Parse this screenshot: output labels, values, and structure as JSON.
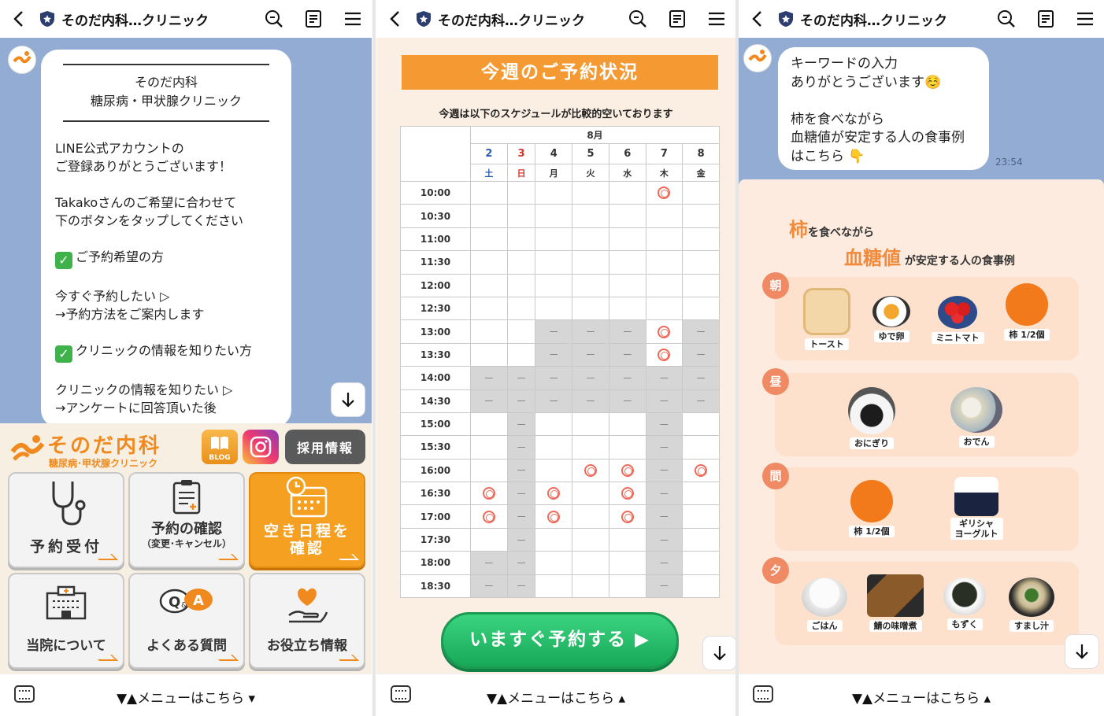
{
  "header": {
    "title": "そのだ内科…クリニック"
  },
  "footer": {
    "menu_label_1": "▼▲メニューはこちら ▾",
    "menu_label_2": "▼▲メニューはこちら ▴",
    "menu_label_3": "▼▲メニューはこちら ▴"
  },
  "screen1": {
    "clinic_line1": "そのだ内科",
    "clinic_line2": "糖尿病・甲状腺クリニック",
    "message": "LINE公式アカウントの\nご登録ありがとうございます！\n\nTakakoさんのご希望に合わせて\n下のボタンをタップしてください\n\n✅ご予約希望の方\n\n今すぐ予約したい ▷\n→予約方法をご案内します\n\n✅クリニックの情報を知りたい方\n\nクリニックの情報を知りたい ▷\n→アンケートに回答頂いた後",
    "menu": {
      "logo_name": "そのだ内科",
      "logo_sub": "糖尿病･甲状腺クリニック",
      "blog": "BLOG",
      "recruit": "採用情報",
      "tiles": [
        {
          "label": "予約受付",
          "sub": ""
        },
        {
          "label": "予約の確認",
          "sub": "（変更･キャンセル）"
        },
        {
          "label": "空き日程を\n確認",
          "sub": ""
        },
        {
          "label": "当院について",
          "sub": ""
        },
        {
          "label": "よくある質問",
          "sub": ""
        },
        {
          "label": "お役立ち情報",
          "sub": ""
        }
      ],
      "qa": "Q&A"
    }
  },
  "screen2": {
    "banner": "今週のご予約状況",
    "subtitle": "今週は以下のスケジュールが比較的空いております",
    "month": "8月",
    "dates": [
      "2",
      "3",
      "4",
      "5",
      "6",
      "7",
      "8"
    ],
    "weekdays": [
      "土",
      "日",
      "月",
      "火",
      "水",
      "木",
      "金"
    ],
    "date_colors": [
      "#2a5db0",
      "#d8322d",
      "#333333",
      "#333333",
      "#333333",
      "#333333",
      "#333333"
    ],
    "times": [
      "10:00",
      "10:30",
      "11:00",
      "11:30",
      "12:00",
      "12:30",
      "13:00",
      "13:30",
      "14:00",
      "14:30",
      "15:00",
      "15:30",
      "16:00",
      "16:30",
      "17:00",
      "17:30",
      "18:00",
      "18:30"
    ],
    "grid": [
      [
        "e",
        "e",
        "e",
        "e",
        "e",
        "o",
        "e"
      ],
      [
        "e",
        "e",
        "e",
        "e",
        "e",
        "e",
        "e"
      ],
      [
        "e",
        "e",
        "e",
        "e",
        "e",
        "e",
        "e"
      ],
      [
        "e",
        "e",
        "e",
        "e",
        "e",
        "e",
        "e"
      ],
      [
        "e",
        "e",
        "e",
        "e",
        "e",
        "e",
        "e"
      ],
      [
        "e",
        "e",
        "e",
        "e",
        "e",
        "e",
        "e"
      ],
      [
        "e",
        "e",
        "g",
        "g",
        "g",
        "o",
        "g"
      ],
      [
        "e",
        "e",
        "g",
        "g",
        "g",
        "o",
        "g"
      ],
      [
        "g",
        "g",
        "g",
        "g",
        "g",
        "g",
        "g"
      ],
      [
        "g",
        "g",
        "g",
        "g",
        "g",
        "g",
        "g"
      ],
      [
        "e",
        "d",
        "e",
        "e",
        "e",
        "d",
        "e"
      ],
      [
        "e",
        "d",
        "e",
        "e",
        "e",
        "d",
        "e"
      ],
      [
        "e",
        "d",
        "e",
        "o",
        "o",
        "d",
        "o"
      ],
      [
        "o",
        "d",
        "o",
        "e",
        "o",
        "d",
        "e"
      ],
      [
        "o",
        "d",
        "o",
        "e",
        "o",
        "d",
        "e"
      ],
      [
        "e",
        "d",
        "e",
        "e",
        "e",
        "d",
        "e"
      ],
      [
        "g",
        "d",
        "e",
        "e",
        "e",
        "d",
        "e"
      ],
      [
        "g",
        "d",
        "e",
        "e",
        "e",
        "d",
        "e"
      ]
    ],
    "dash": "ー",
    "cta": "いますぐ予約する ▶"
  },
  "screen3": {
    "message": "キーワードの入力\nありがとうございます☺️\n\n柿を食べながら\n血糖値が安定する人の食事例\nはこちら 👇",
    "time": "23:54",
    "heading1_big": "柿",
    "heading1_rest": "を食べながら",
    "heading2_big": "血糖値",
    "heading2_rest": "が安定する人の食事例",
    "meals": [
      {
        "badge": "朝",
        "foods": [
          "トースト",
          "ゆで卵",
          "ミニトマト",
          "柿 1/2個"
        ]
      },
      {
        "badge": "昼",
        "foods": [
          "おにぎり",
          "おでん"
        ]
      },
      {
        "badge": "間",
        "foods": [
          "柿 1/2個",
          "ギリシャ\nヨーグルト"
        ]
      },
      {
        "badge": "夕",
        "foods": [
          "ごはん",
          "鯖の味噌煮",
          "もずく",
          "すまし汁"
        ]
      }
    ]
  }
}
